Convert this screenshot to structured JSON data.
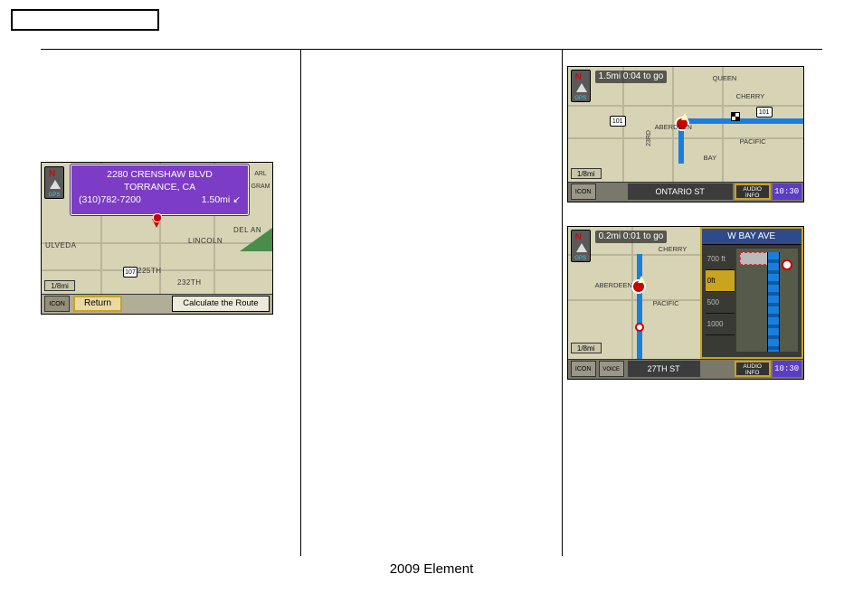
{
  "footer": "2009  Element",
  "left_nav": {
    "compass": {
      "letter": "N",
      "gps": "GPS"
    },
    "infobox": {
      "line1": "2280 CRENSHAW BLVD",
      "line2": "TORRANCE, CA",
      "phone": "(310)782-7200",
      "dist": "1.50mi",
      "arrow": "↙"
    },
    "right_axis": [
      "ARL",
      "GRAM"
    ],
    "map_labels": {
      "lincoln": "LINCOLN",
      "del": "DEL AN",
      "two25": "225TH",
      "two32": "232TH",
      "ulveda": "ULVEDA"
    },
    "shields": [
      "107"
    ],
    "scale": "1/8mi",
    "icon_button": "ICON",
    "return_button": "Return",
    "calc_button": "Calculate the Route"
  },
  "right_nav1": {
    "compass": {
      "letter": "N",
      "gps": "GPS"
    },
    "status": "1.5mi 0:04 to go",
    "shields": {
      "left": "101",
      "right": "101"
    },
    "streets": {
      "queen": "QUEEN",
      "cherry": "CHERRY",
      "aberdeen": "ABERDEEN",
      "pacific": "PACIFIC",
      "bay": "BAY",
      "v23rd": "23RD"
    },
    "scale": "1/8mi",
    "icon_button": "ICON",
    "current_street": "ONTARIO ST",
    "audio_label": "AUDIO\nINFO",
    "clock": "10:30"
  },
  "right_nav2": {
    "compass": {
      "letter": "N",
      "gps": "GPS"
    },
    "status": "0.2mi 0:01 to go",
    "guide_street": "W BAY AVE",
    "distbar": [
      "700 ft",
      "0ft",
      "500",
      "1000"
    ],
    "streets": {
      "cherry": "CHERRY",
      "aberdeen": "ABERDEEN",
      "pacific": "PACIFIC"
    },
    "scale": "1/8mi",
    "icon_button": "ICON",
    "voice_button": "VOICE",
    "current_street": "27TH ST",
    "audio_label": "AUDIO\nINFO",
    "clock": "10:30"
  }
}
